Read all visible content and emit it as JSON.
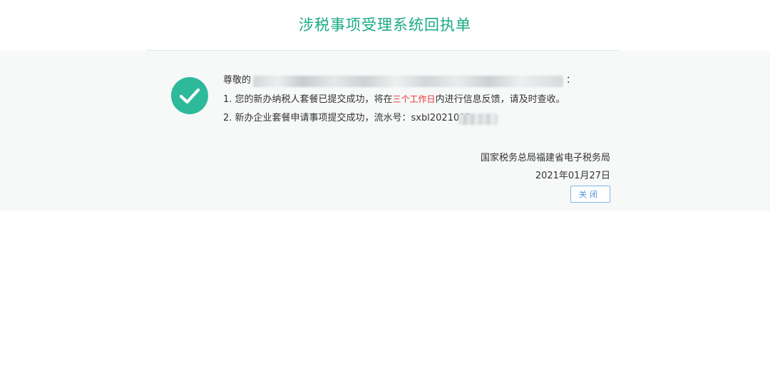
{
  "header": {
    "title": "涉税事项受理系统回执单"
  },
  "receipt": {
    "greeting_prefix": "尊敬的",
    "greeting_suffix": "：",
    "item1_before": "1. 您的新办纳税人套餐已提交成功，将在",
    "item1_highlight": "三个工作日",
    "item1_after": "内进行信息反馈，请及时查收。",
    "item2_text": "2. 新办企业套餐申请事项提交成功，流水号：sxbl2021012"
  },
  "signature": {
    "organization": "国家税务总局福建省电子税务局",
    "date": "2021年01月27日"
  },
  "actions": {
    "close_label": "关闭"
  },
  "colors": {
    "title": "#1aaa84",
    "success_icon": "#2fb99b",
    "highlight": "#e8322e",
    "button_border": "#7fb8e6"
  },
  "icons": {
    "status": "check-circle-icon"
  }
}
